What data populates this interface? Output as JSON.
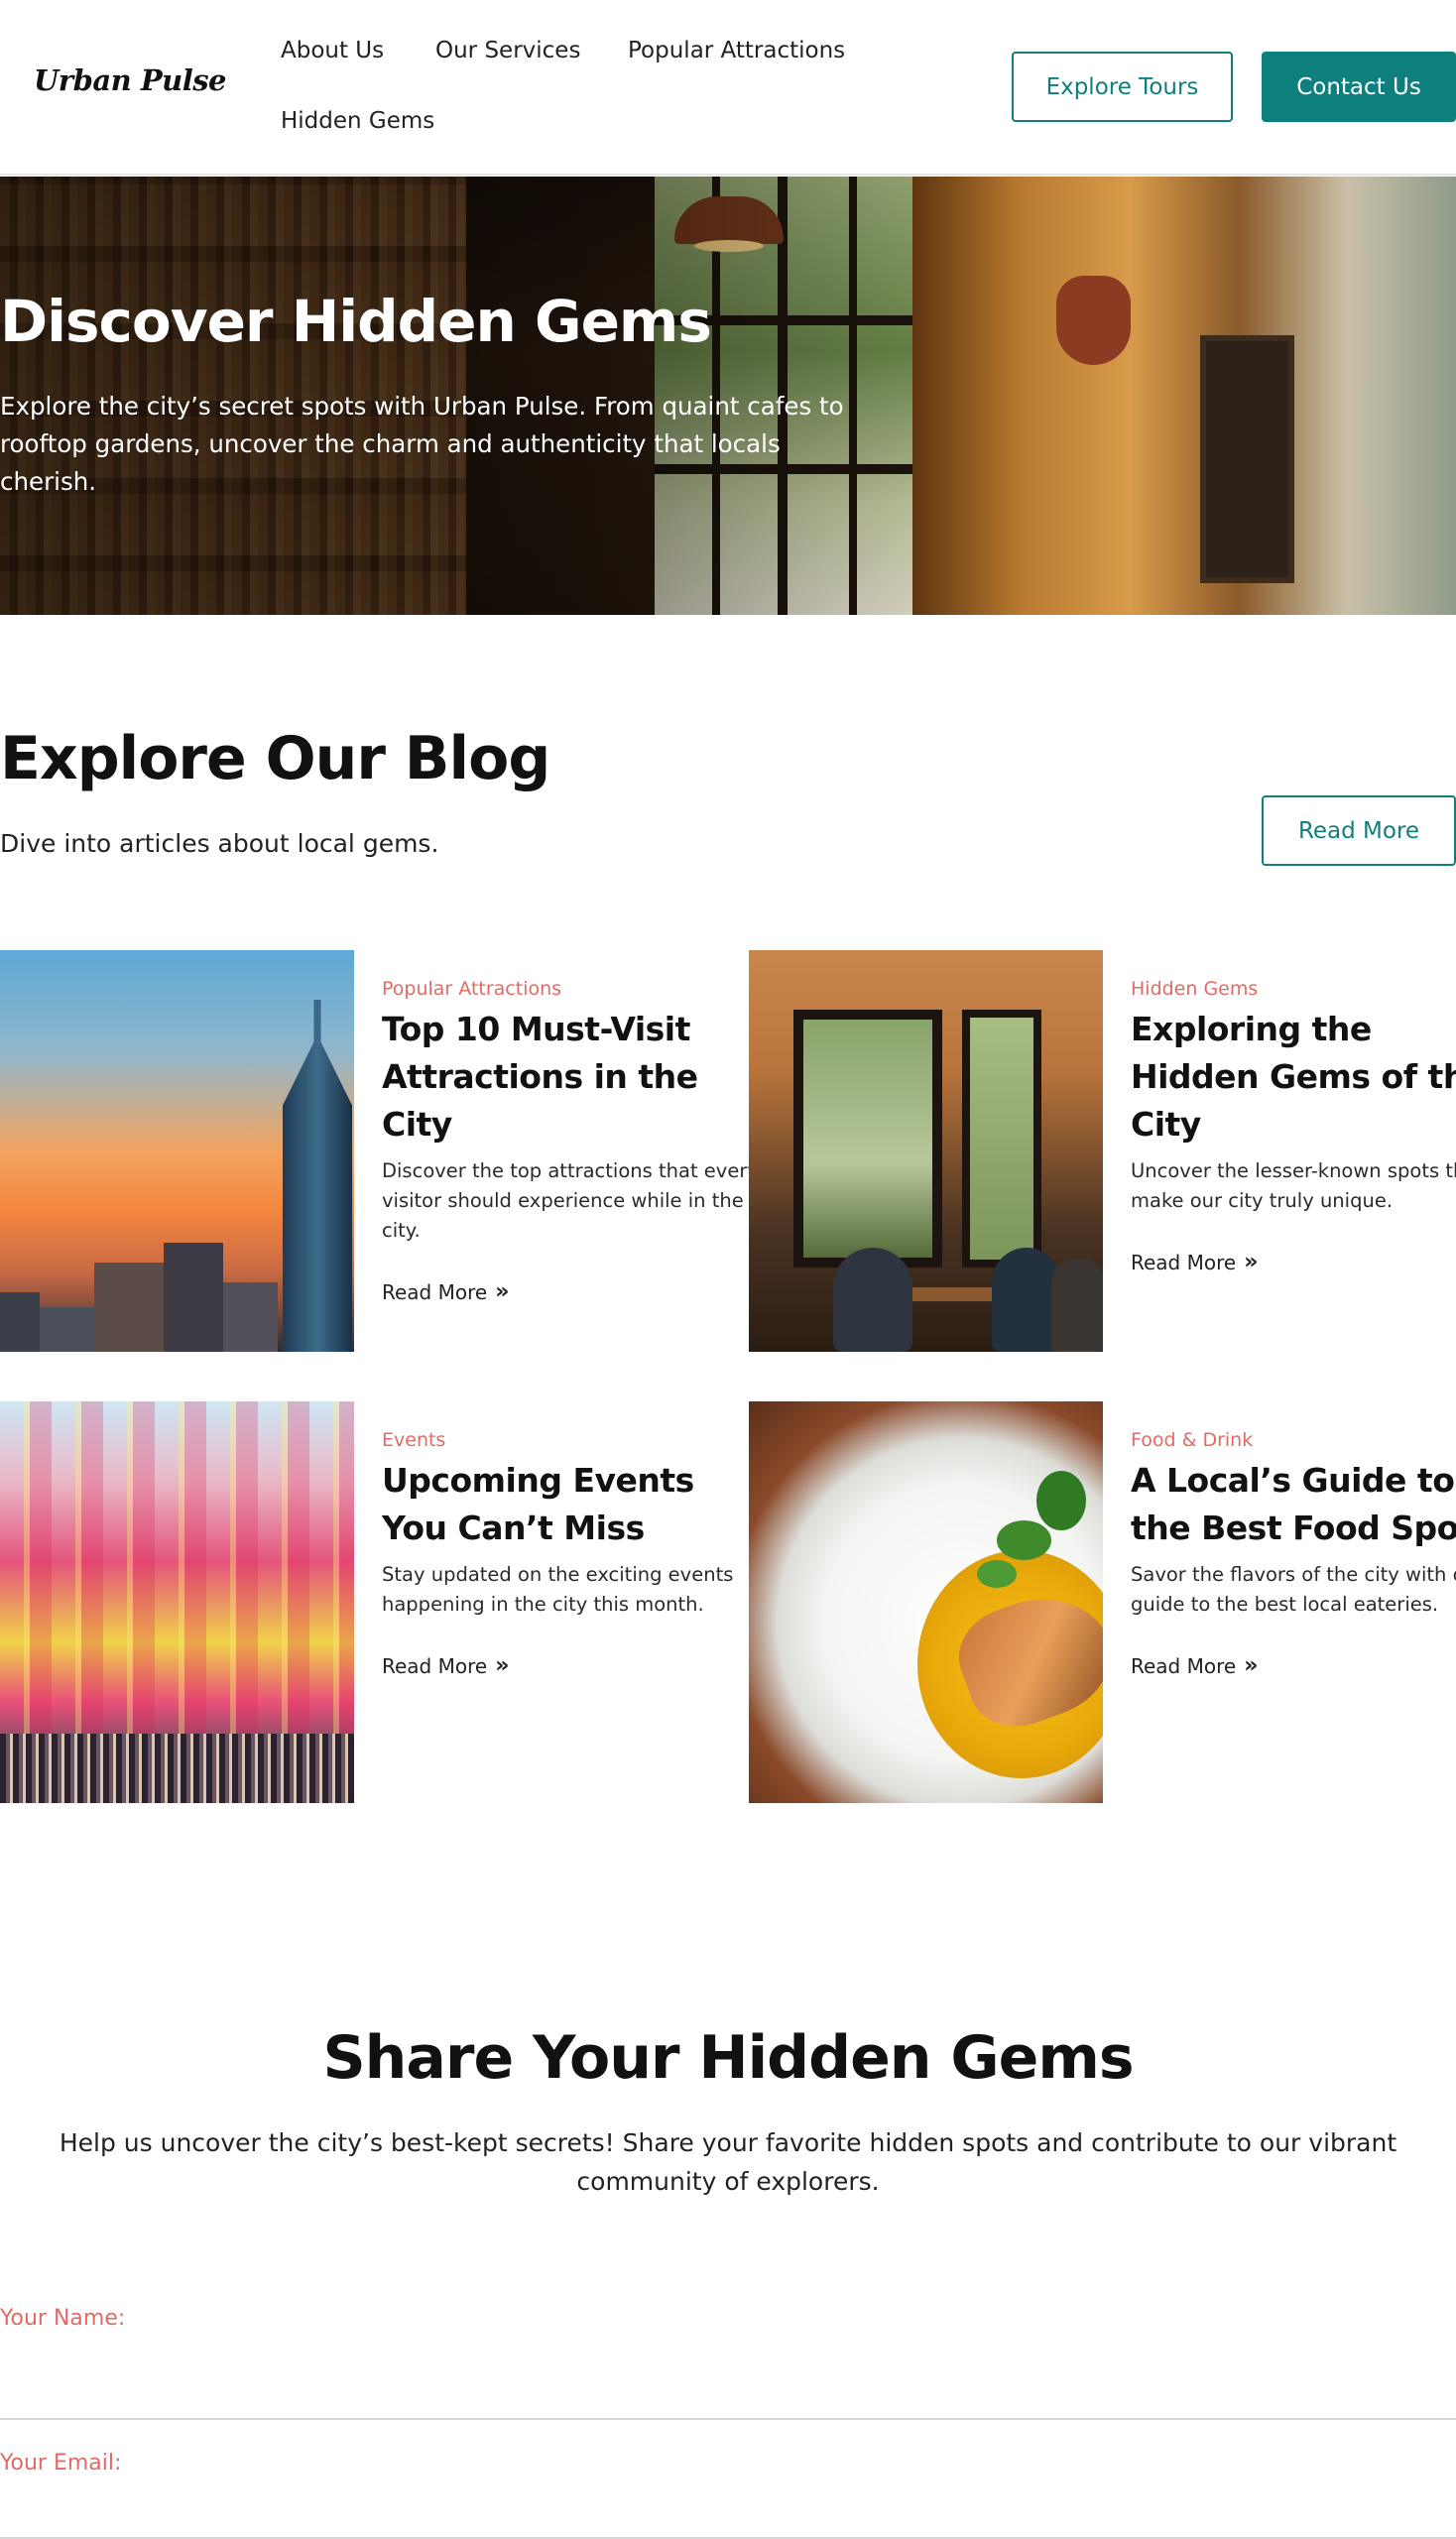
{
  "brand": {
    "logo": "Urban Pulse"
  },
  "nav": {
    "items": [
      {
        "label": "About Us"
      },
      {
        "label": "Our Services"
      },
      {
        "label": "Popular Attractions"
      },
      {
        "label": "Hidden Gems"
      }
    ],
    "explore_label": "Explore Tours",
    "contact_label": "Contact Us"
  },
  "hero": {
    "title": "Discover Hidden Gems",
    "text": "Explore the city’s secret spots with Urban Pulse. From quaint cafes to rooftop gardens, uncover the charm and authenticity that locals cherish."
  },
  "blog": {
    "title": "Explore Our Blog",
    "subtitle": "Dive into articles about local gems.",
    "read_more_label": "Read More",
    "cards": [
      {
        "category": "Popular Attractions",
        "title": "Top 10 Must-Visit Attractions in the City",
        "description": "Discover the top attractions that every visitor should experience while in the city.",
        "link": "Read More"
      },
      {
        "category": "Hidden Gems",
        "title": "Exploring the Hidden Gems of the City",
        "description": "Uncover the lesser-known spots that make our city truly unique.",
        "link": "Read More"
      },
      {
        "category": "Events",
        "title": "Upcoming Events You Can’t Miss",
        "description": "Stay updated on the exciting events happening in the city this month.",
        "link": "Read More"
      },
      {
        "category": "Food & Drink",
        "title": "A Local’s Guide to the Best Food Spots",
        "description": "Savor the flavors of the city with our guide to the best local eateries.",
        "link": "Read More"
      }
    ]
  },
  "share": {
    "title": "Share Your Hidden Gems",
    "text": "Help us uncover the city’s best-kept secrets! Share your favorite hidden spots and contribute to our vibrant community of explorers.",
    "name_label": "Your Name:",
    "email_label": "Your Email:"
  },
  "icons": {
    "read_more": "double-chevron-right-icon"
  },
  "colors": {
    "accent": "#0d7f7d",
    "category": "#e06b66",
    "text": "#111111"
  }
}
